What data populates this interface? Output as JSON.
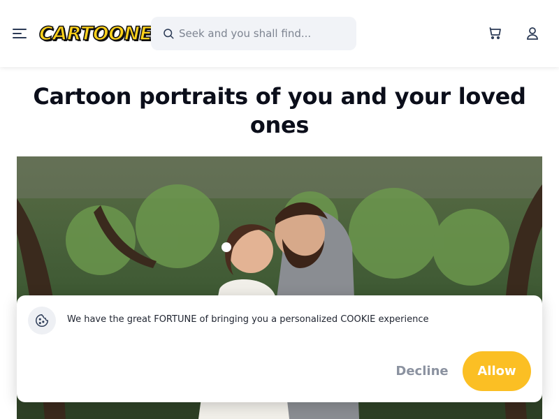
{
  "header": {
    "logo_text": "CARTOONELY",
    "search_placeholder": "Seek and you shall find..."
  },
  "main": {
    "title": "Cartoon portraits of you and your loved ones"
  },
  "cookie_banner": {
    "message": "We have the great FORTUNE of bringing you a personalized COOKIE experience",
    "decline_label": "Decline",
    "allow_label": "Allow"
  },
  "colors": {
    "accent": "#fbbf24",
    "logo_yellow": "#ffd21a",
    "icon": "#2b3a55"
  },
  "icons": [
    "hamburger-menu-icon",
    "search-icon",
    "cart-icon",
    "user-icon",
    "cookie-icon"
  ]
}
